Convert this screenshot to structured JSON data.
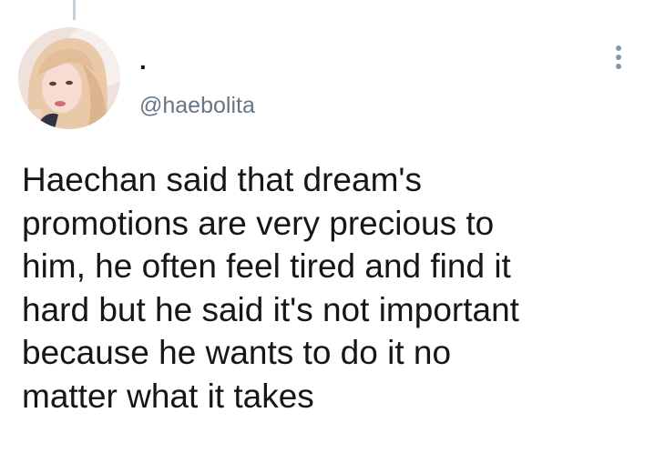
{
  "tweet": {
    "author": {
      "display_name": ".",
      "handle": "@haebolita",
      "avatar_icon": "profile-photo"
    },
    "more_icon": "more-vertical-icon",
    "text_lines": [
      "Haechan said that dream's",
      "promotions are very precious to",
      "him, he often feel tired and find it",
      "hard but he said it's not important",
      "because he wants to do it no",
      "matter what it takes"
    ]
  },
  "colors": {
    "text": "#14171a",
    "secondary_text": "#657786",
    "thread_line": "#c4cfd6",
    "icon": "#8899a6"
  }
}
